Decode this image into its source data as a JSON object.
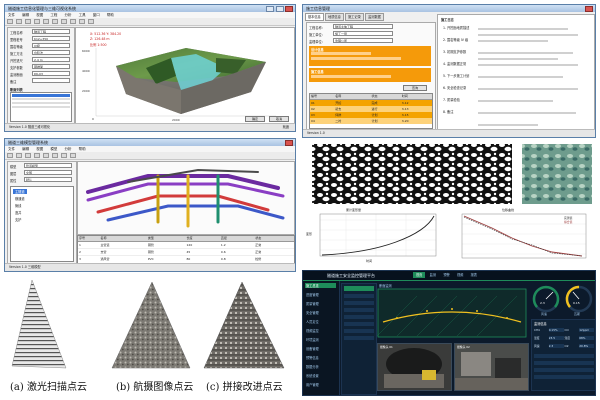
{
  "colors": {
    "window_border": "#5a7fa8",
    "orange_form": "#f59a0a",
    "dashboard_bg": "#0c1a2b",
    "dashboard_accent": "#1e8c5a",
    "report_orange": "#f4a300"
  },
  "panel_a": {
    "title": "隧道施工信息化管理与三维可视化系统",
    "menus": [
      "文件",
      "编辑",
      "视图",
      "工程",
      "分析",
      "工具",
      "窗口",
      "帮助"
    ],
    "left_labels": [
      "工程名称",
      "里程桩号",
      "围岩等级",
      "施工方法",
      "开挖进尺",
      "支护参数",
      "监测断面",
      "备注"
    ],
    "left_values": [
      "隧道工程",
      "K12+350",
      "IV级",
      "台阶法",
      "2.4 m",
      "钢拱架",
      "DK-03",
      ""
    ],
    "list_title": "断面列表",
    "status_left": "Version 1.0 隧道三维可视化",
    "status_right": "就绪",
    "btn_ok": "确定",
    "btn_cancel": "取消",
    "overlay_lines": [
      "X: 512.36  Y: 384.20",
      "Z: 126.48  m",
      "比例 1:500"
    ],
    "axis_labels": [
      "6000",
      "4000",
      "2000",
      "0",
      "2000",
      "4000"
    ]
  },
  "panel_b": {
    "title": "施工信息管理",
    "tabs": [
      "基本信息",
      "地质信息",
      "施工记录",
      "监测数据"
    ],
    "form_labels": [
      "工程名称:",
      "施工单位:",
      "监理单位:"
    ],
    "form_values": [
      "隧道主体工程",
      "施工一局",
      "监理公司"
    ],
    "section1": "设计信息",
    "section2": "施工信息",
    "btn_query": "查询",
    "table_headers": [
      "编号",
      "名称",
      "状态",
      "时间"
    ],
    "table_rows": [
      [
        "01",
        "开挖",
        "完成",
        "3-12"
      ],
      [
        "02",
        "初支",
        "进行",
        "3-13"
      ],
      [
        "03",
        "仰拱",
        "计划",
        "3-15"
      ],
      [
        "04",
        "二衬",
        "计划",
        "3-20"
      ]
    ],
    "right_title": "施工日志",
    "right_lines": [
      "1. 开挖面地质描述",
      "2. 围岩等级 IV 级",
      "3. 初期支护参数",
      "4. 监测数据正常",
      "5. 下一步施工计划",
      "6. 安全检查记录",
      "7. 质量检验",
      "8. 备注"
    ],
    "status": "Version 1.0"
  },
  "panel_c": {
    "title": "隧道三维模型管理系统",
    "menus": [
      "文件",
      "编辑",
      "视图",
      "模型",
      "分析",
      "帮助"
    ],
    "left_labels": [
      "模型",
      "图层",
      "属性"
    ],
    "left_values": [
      "管道模型",
      "全部",
      "默认"
    ],
    "tree_items": [
      "主隧道",
      "横通道",
      "管线",
      "竖井",
      "支护"
    ],
    "table_headers": [
      "序号",
      "名称",
      "类型",
      "长度",
      "直径",
      "状态"
    ],
    "table_rows": [
      [
        "1",
        "主管道",
        "钢管",
        "120",
        "1.2",
        "正常"
      ],
      [
        "2",
        "支管",
        "钢管",
        "45",
        "0.6",
        "正常"
      ],
      [
        "3",
        "通风管",
        "PVC",
        "80",
        "0.8",
        "检修"
      ]
    ],
    "status": "Version 1.0 三维模型"
  },
  "panel_d": {
    "left_chart": {
      "title": "累计变形量",
      "xlabel": "时间",
      "ylabel": "变形"
    },
    "right_chart": {
      "title": "位移曲线",
      "legend": [
        "实测值",
        "拟合值"
      ]
    }
  },
  "panel_e": {
    "captions": [
      "(a) 激光扫描点云",
      "(b) 航摄图像点云",
      "(c) 拼接改进点云"
    ]
  },
  "panel_f": {
    "title": "隧道施工安全监控管理平台",
    "tabs": [
      "首页",
      "监测",
      "预警",
      "视频",
      "报表"
    ],
    "sidebar_items": [
      "施工总览",
      "进度管理",
      "质量管理",
      "安全管理",
      "人员定位",
      "视频监控",
      "环境监测",
      "设备管理",
      "预警信息",
      "数据分析",
      "系统设置",
      "用户管理"
    ],
    "gauge_labels": [
      "风速",
      "瓦斯"
    ],
    "gauge_values": [
      "2.3",
      "0.15"
    ],
    "info_title": "监测信息",
    "info_rows": [
      [
        "CH4",
        "0.15%",
        "CO",
        "12ppm"
      ],
      [
        "温度",
        "23.5",
        "湿度",
        "68%"
      ],
      [
        "风速",
        "2.3",
        "O2",
        "20.8%"
      ]
    ],
    "video_labels": [
      "摄像头 01",
      "摄像头 02"
    ],
    "section_label": "断面监测"
  }
}
